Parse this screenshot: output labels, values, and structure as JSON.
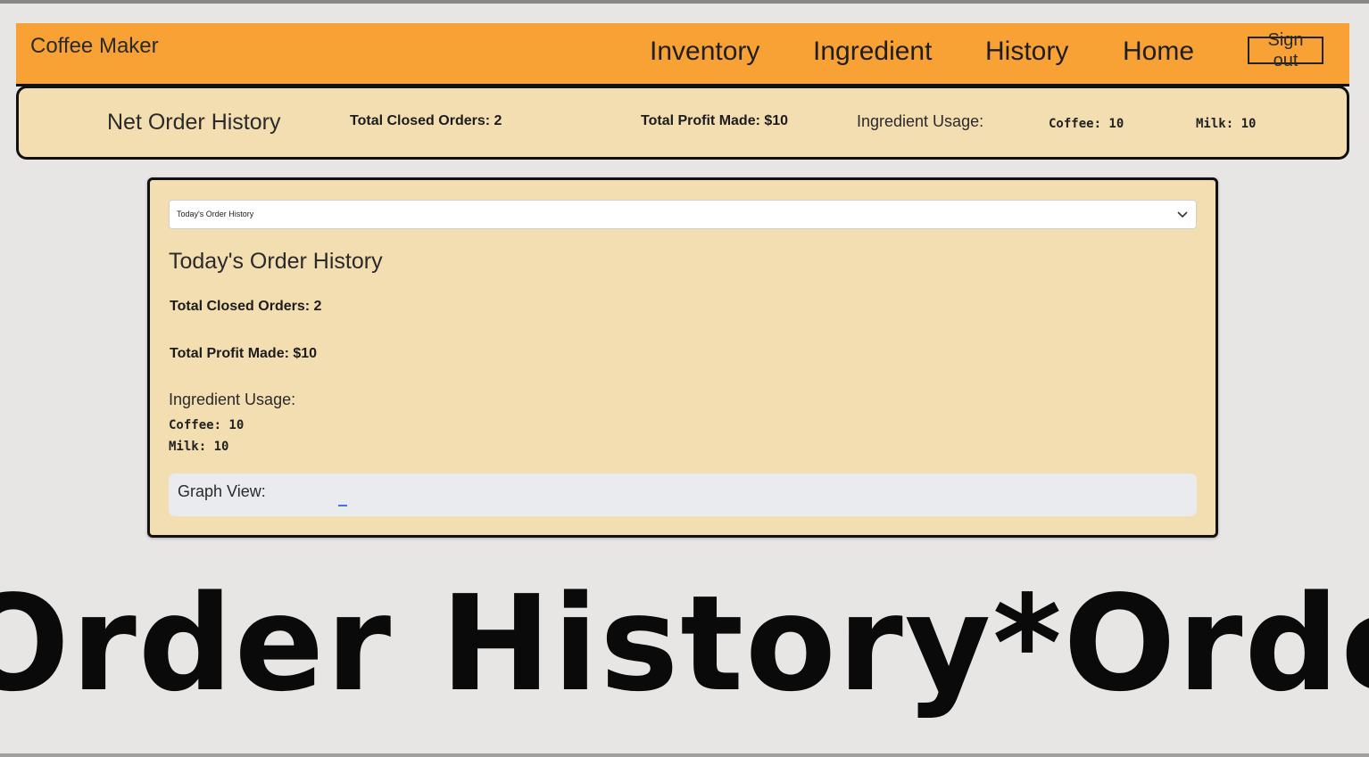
{
  "navbar": {
    "brand": "Coffee Maker",
    "links": [
      "Inventory",
      "Ingredient",
      "History",
      "Home"
    ],
    "signout_label": "Sign out",
    "color": "#f8a236"
  },
  "summary": {
    "title": "Net Order History",
    "closed_orders": "Total Closed Orders: 2",
    "profit": "Total Profit Made: $10",
    "usage_label": "Ingredient Usage:",
    "coffee": "Coffee: 10",
    "milk": "Milk: 10"
  },
  "card": {
    "select_value": "Today's Order History",
    "title": "Today's Order History",
    "closed_orders": "Total Closed Orders: 2",
    "profit": "Total Profit Made: $10",
    "usage_label": "Ingredient Usage:",
    "coffee": "Coffee: 10",
    "milk": "Milk: 10",
    "graph_label": "Graph View:"
  },
  "marquee": {
    "text": "Order History*Order History*Order History"
  },
  "colors": {
    "background": "#e8e6e4",
    "panel": "#f3deb2",
    "graph_bg": "#e9ebef"
  }
}
